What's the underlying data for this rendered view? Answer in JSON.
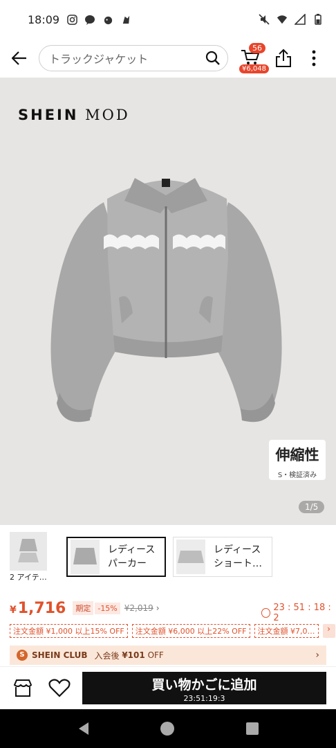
{
  "status_bar": {
    "time": "18:09"
  },
  "search": {
    "value": "トラックジャケット"
  },
  "cart": {
    "count": "56",
    "total": "¥6,048"
  },
  "hero": {
    "brand_a": "SHEIN",
    "brand_b": "MOD",
    "badge_main": "伸縮性",
    "badge_sub": "S・検証済み",
    "page_indicator": "1/5"
  },
  "variants": {
    "all_label": "2 アイテ…",
    "items": [
      {
        "line1": "レディース",
        "line2": "パーカー"
      },
      {
        "line1": "レディース",
        "line2": "ショート…"
      }
    ]
  },
  "pricing": {
    "currency": "¥",
    "price": "1,716",
    "limited_label": "期定",
    "discount": "-15%",
    "original": "¥2,019",
    "timer": "23 : 51 : 18 : 2"
  },
  "coupons": [
    "注文金額 ¥1,000 以上15% OFF",
    "注文金額 ¥6,000 以上22% OFF",
    "注文金額 ¥7,0…"
  ],
  "club": {
    "name": "SHEIN CLUB",
    "text": "入会後",
    "amount": "¥101",
    "off": "OFF"
  },
  "bottom": {
    "add_to_cart": "買い物かごに追加",
    "timer": "23:51:19:3"
  },
  "colors": {
    "accent": "#e0522c",
    "hero_bg": "#e6e5e3",
    "club_bg": "#fbe7d9",
    "button_bg": "#111111"
  }
}
